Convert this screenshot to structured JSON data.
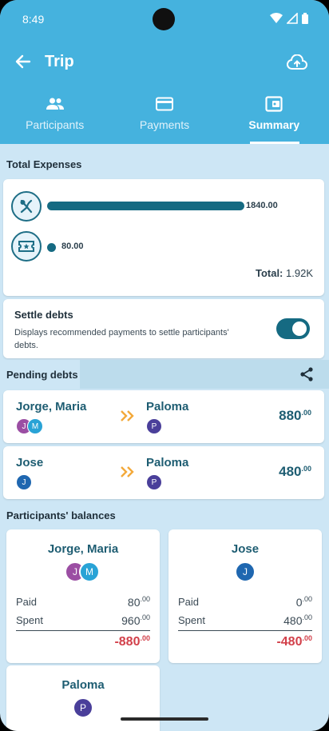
{
  "status": {
    "time": "8:49"
  },
  "appbar": {
    "title": "Trip"
  },
  "tabs": [
    {
      "label": "Participants",
      "icon": "people-icon"
    },
    {
      "label": "Payments",
      "icon": "card-icon"
    },
    {
      "label": "Summary",
      "icon": "wallet-icon",
      "active": true
    }
  ],
  "total_expenses": {
    "title": "Total Expenses",
    "categories": [
      {
        "icon": "utensils-icon",
        "value_label": "1840.00",
        "value": 1840
      },
      {
        "icon": "ticket-icon",
        "value_label": "80.00",
        "value": 80
      }
    ],
    "total_label": "Total:",
    "total_value": "1.92K"
  },
  "settle": {
    "title": "Settle debts",
    "description": "Displays recommended payments to settle participants' debts.",
    "enabled": true
  },
  "pending": {
    "title": "Pending debts",
    "debts": [
      {
        "from": "Jorge, Maria",
        "from_avatars": [
          "J",
          "M"
        ],
        "to": "Paloma",
        "to_avatar": "P",
        "amount_int": "880",
        "amount_dec": ".00"
      },
      {
        "from": "Jose",
        "from_avatars": [
          "J"
        ],
        "to": "Paloma",
        "to_avatar": "P",
        "amount_int": "480",
        "amount_dec": ".00"
      }
    ]
  },
  "balances": {
    "title": "Participants' balances",
    "paid_label": "Paid",
    "spent_label": "Spent",
    "items": [
      {
        "name": "Jorge, Maria",
        "avatars": [
          "J",
          "M"
        ],
        "paid_int": "80",
        "paid_dec": ".00",
        "spent_int": "960",
        "spent_dec": ".00",
        "net_int": "-880",
        "net_dec": ".00"
      },
      {
        "name": "Jose",
        "avatars": [
          "J"
        ],
        "paid_int": "0",
        "paid_dec": ".00",
        "spent_int": "480",
        "spent_dec": ".00",
        "net_int": "-480",
        "net_dec": ".00"
      },
      {
        "name": "Paloma",
        "avatars": [
          "P"
        ]
      }
    ]
  },
  "colors": {
    "appbar": "#45b2de",
    "background": "#cde6f5",
    "accent": "#156a82",
    "negative": "#d2404a",
    "chevron": "#f3a93a",
    "avatar_jorge": "#9b4ea3",
    "avatar_maria": "#29a3d6",
    "avatar_jose": "#1f67b0",
    "avatar_paloma": "#4a3f9a"
  }
}
